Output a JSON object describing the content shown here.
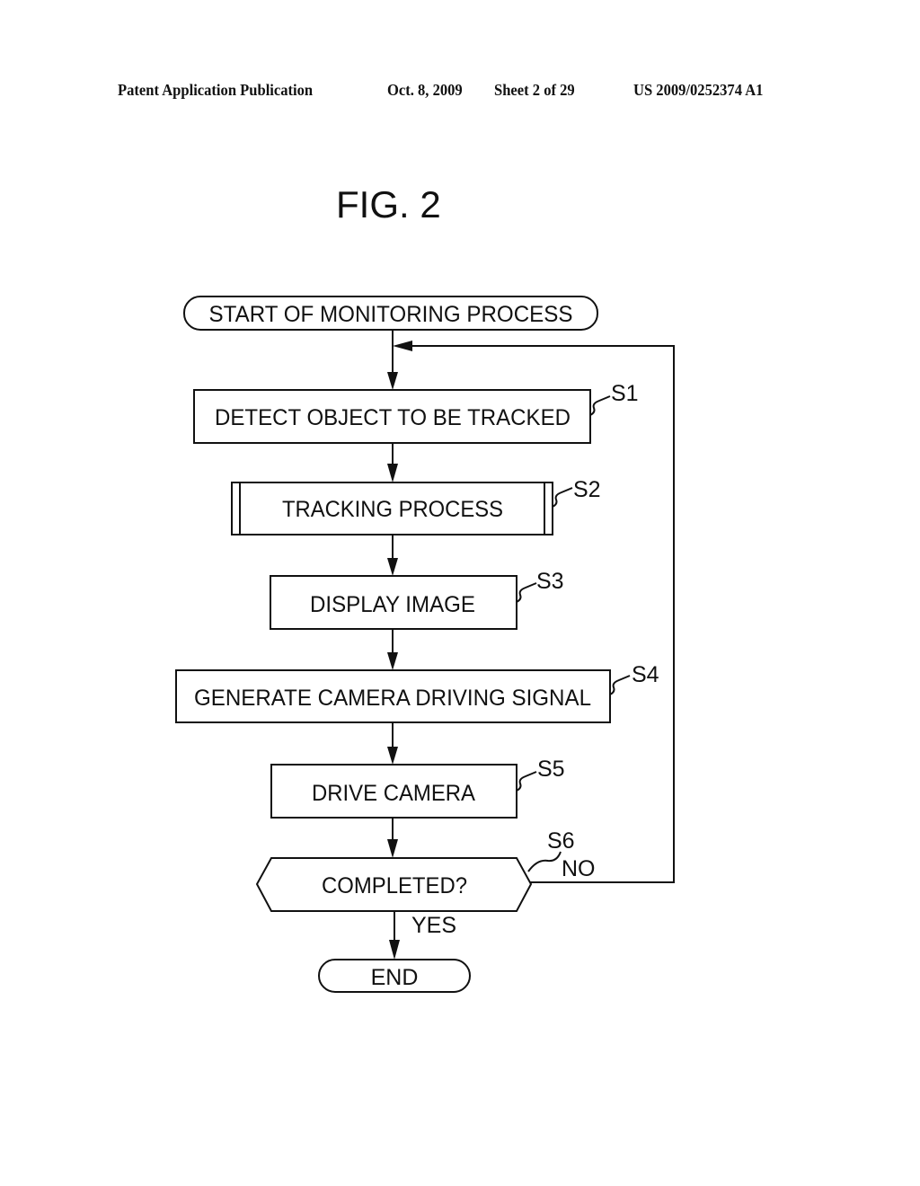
{
  "header": {
    "publication": "Patent Application Publication",
    "date": "Oct. 8, 2009",
    "sheet": "Sheet 2 of 29",
    "number": "US 2009/0252374 A1"
  },
  "figure": {
    "title": "FIG. 2"
  },
  "flowchart": {
    "start": "START OF MONITORING PROCESS",
    "steps": [
      {
        "id": "S1",
        "label": "DETECT OBJECT TO BE TRACKED",
        "type": "process"
      },
      {
        "id": "S2",
        "label": "TRACKING PROCESS",
        "type": "predefined-process"
      },
      {
        "id": "S3",
        "label": "DISPLAY IMAGE",
        "type": "process"
      },
      {
        "id": "S4",
        "label": "GENERATE CAMERA DRIVING SIGNAL",
        "type": "process"
      },
      {
        "id": "S5",
        "label": "DRIVE CAMERA",
        "type": "process"
      },
      {
        "id": "S6",
        "label": "COMPLETED?",
        "type": "decision"
      }
    ],
    "branches": {
      "no": "NO",
      "yes": "YES"
    },
    "end": "END"
  }
}
